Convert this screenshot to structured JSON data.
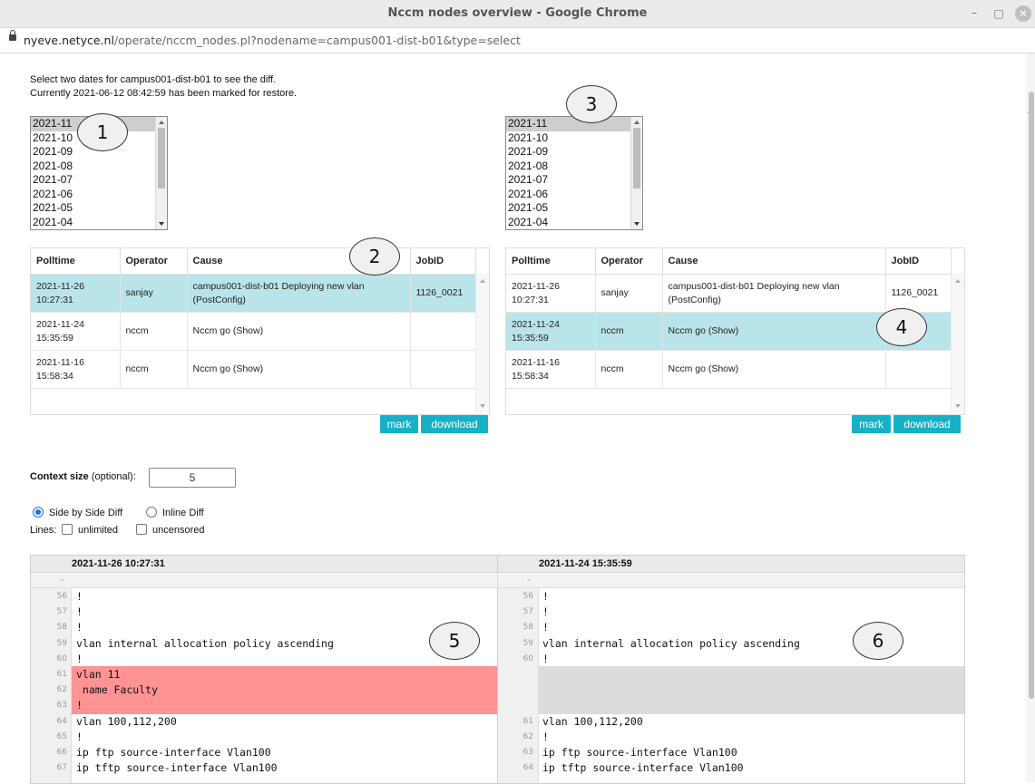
{
  "window": {
    "title": "Nccm nodes overview - Google Chrome",
    "minimize": "–",
    "maximize": "□",
    "close": "×"
  },
  "address_bar": {
    "host": "nyeve.netyce.nl",
    "path": "/operate/nccm_nodes.pl?nodename=campus001-dist-b01&type=select"
  },
  "intro": {
    "line1": "Select two dates for campus001-dist-b01 to see the diff.",
    "line2": "Currently 2021-06-12 08:42:59 has been marked for restore."
  },
  "left_months": [
    "2021-11",
    "2021-10",
    "2021-09",
    "2021-08",
    "2021-07",
    "2021-06",
    "2021-05",
    "2021-04"
  ],
  "right_months": [
    "2021-11",
    "2021-10",
    "2021-09",
    "2021-08",
    "2021-07",
    "2021-06",
    "2021-05",
    "2021-04"
  ],
  "columns": [
    "Polltime",
    "Operator",
    "Cause",
    "JobID"
  ],
  "left_rows": [
    {
      "polltime_date": "2021-11-26",
      "polltime_time": "10:27:31",
      "operator": "sanjay",
      "cause_1": "campus001-dist-b01 Deploying new vlan",
      "cause_2": "(PostConfig)",
      "jobid": "1126_0021"
    },
    {
      "polltime_date": "2021-11-24",
      "polltime_time": "15:35:59",
      "operator": "nccm",
      "cause_1": "Nccm go (Show)",
      "cause_2": "",
      "jobid": ""
    },
    {
      "polltime_date": "2021-11-16",
      "polltime_time": "15:58:34",
      "operator": "nccm",
      "cause_1": "Nccm go (Show)",
      "cause_2": "",
      "jobid": ""
    }
  ],
  "right_rows": [
    {
      "polltime_date": "2021-11-26",
      "polltime_time": "10:27:31",
      "operator": "sanjay",
      "cause_1": "campus001-dist-b01 Deploying new vlan",
      "cause_2": "(PostConfig)",
      "jobid": "1126_0021"
    },
    {
      "polltime_date": "2021-11-24",
      "polltime_time": "15:35:59",
      "operator": "nccm",
      "cause_1": "Nccm go (Show)",
      "cause_2": "",
      "jobid": ""
    },
    {
      "polltime_date": "2021-11-16",
      "polltime_time": "15:58:34",
      "operator": "nccm",
      "cause_1": "Nccm go (Show)",
      "cause_2": "",
      "jobid": ""
    }
  ],
  "buttons": {
    "mark": "mark",
    "download": "download"
  },
  "context": {
    "label": "Context size",
    "optional": "(optional):",
    "value": "5"
  },
  "diff_mode": {
    "side_by_side": "Side by Side Diff",
    "inline": "Inline Diff"
  },
  "lines": {
    "label": "Lines:",
    "unlimited": "unlimited",
    "uncensored": "uncensored"
  },
  "diff": {
    "left_header": "2021-11-26 10:27:31",
    "right_header": "2021-11-24 15:35:59",
    "left_sub": "–",
    "right_sub": "–",
    "left_lines": [
      {
        "n": "56",
        "t": "!"
      },
      {
        "n": "57",
        "t": "!"
      },
      {
        "n": "58",
        "t": "!"
      },
      {
        "n": "59",
        "t": "vlan internal allocation policy ascending"
      },
      {
        "n": "60",
        "t": "!"
      },
      {
        "n": "61",
        "t": "vlan 11"
      },
      {
        "n": "62",
        "t": " name Faculty"
      },
      {
        "n": "63",
        "t": "!"
      },
      {
        "n": "64",
        "t": "vlan 100,112,200"
      },
      {
        "n": "65",
        "t": "!"
      },
      {
        "n": "66",
        "t": "ip ftp source-interface Vlan100"
      },
      {
        "n": "67",
        "t": "ip tftp source-interface Vlan100"
      }
    ],
    "right_lines": [
      {
        "n": "56",
        "t": "!"
      },
      {
        "n": "57",
        "t": "!"
      },
      {
        "n": "58",
        "t": "!"
      },
      {
        "n": "59",
        "t": "vlan internal allocation policy ascending"
      },
      {
        "n": "60",
        "t": "!"
      },
      {
        "n": "",
        "t": ""
      },
      {
        "n": "",
        "t": ""
      },
      {
        "n": "",
        "t": ""
      },
      {
        "n": "61",
        "t": "vlan 100,112,200"
      },
      {
        "n": "62",
        "t": "!"
      },
      {
        "n": "63",
        "t": "ip ftp source-interface Vlan100"
      },
      {
        "n": "64",
        "t": "ip tftp source-interface Vlan100"
      }
    ]
  },
  "callouts": [
    "1",
    "2",
    "3",
    "4",
    "5",
    "6"
  ],
  "colors": {
    "accent": "#16b1c7",
    "selected_row": "#b9e4ea",
    "deleted_lines": "#fd9393",
    "blank_lines": "#dcdcdc"
  }
}
